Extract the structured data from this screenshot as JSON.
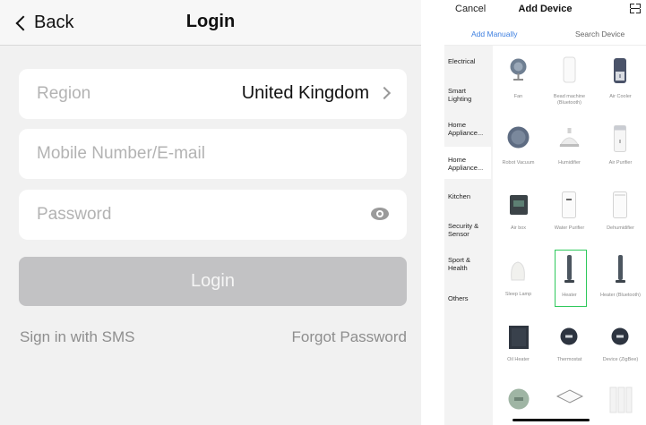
{
  "login": {
    "back_label": "Back",
    "title": "Login",
    "region_label": "Region",
    "region_value": "United Kingdom",
    "mobile_placeholder": "Mobile Number/E-mail",
    "password_placeholder": "Password",
    "login_button": "Login",
    "sms_link": "Sign in with SMS",
    "forgot_link": "Forgot Password"
  },
  "add_device": {
    "cancel_label": "Cancel",
    "title": "Add Device",
    "tabs": [
      "Add Manually",
      "Search Device"
    ],
    "selected_category": "Home Appliance...",
    "categories": [
      {
        "label": "Electrical"
      },
      {
        "label": "Smart Lighting"
      },
      {
        "label": "Home Appliance..."
      },
      {
        "label": "Home Appliance..."
      },
      {
        "label": "Kitchen"
      },
      {
        "label": "Security & Sensor"
      },
      {
        "label": "Sport & Health"
      },
      {
        "label": "Others"
      }
    ],
    "devices": [
      {
        "name": "Fan"
      },
      {
        "name": "Bead machine (Bluetooth)"
      },
      {
        "name": "Air Cooler"
      },
      {
        "name": "Robot Vacuum"
      },
      {
        "name": "Humidifier"
      },
      {
        "name": "Air Purifier"
      },
      {
        "name": "Air box"
      },
      {
        "name": "Water Purifier"
      },
      {
        "name": "Dehumidifier"
      },
      {
        "name": "Sleep Lamp"
      },
      {
        "name": "Heater"
      },
      {
        "name": "Heater (Bluetooth)"
      },
      {
        "name": "Oil Heater"
      },
      {
        "name": "Thermostat"
      },
      {
        "name": "Device (ZigBee)"
      }
    ],
    "selected_device": "Heater",
    "accent_color": "#3d7fe0",
    "selection_color": "#2fc95c"
  }
}
